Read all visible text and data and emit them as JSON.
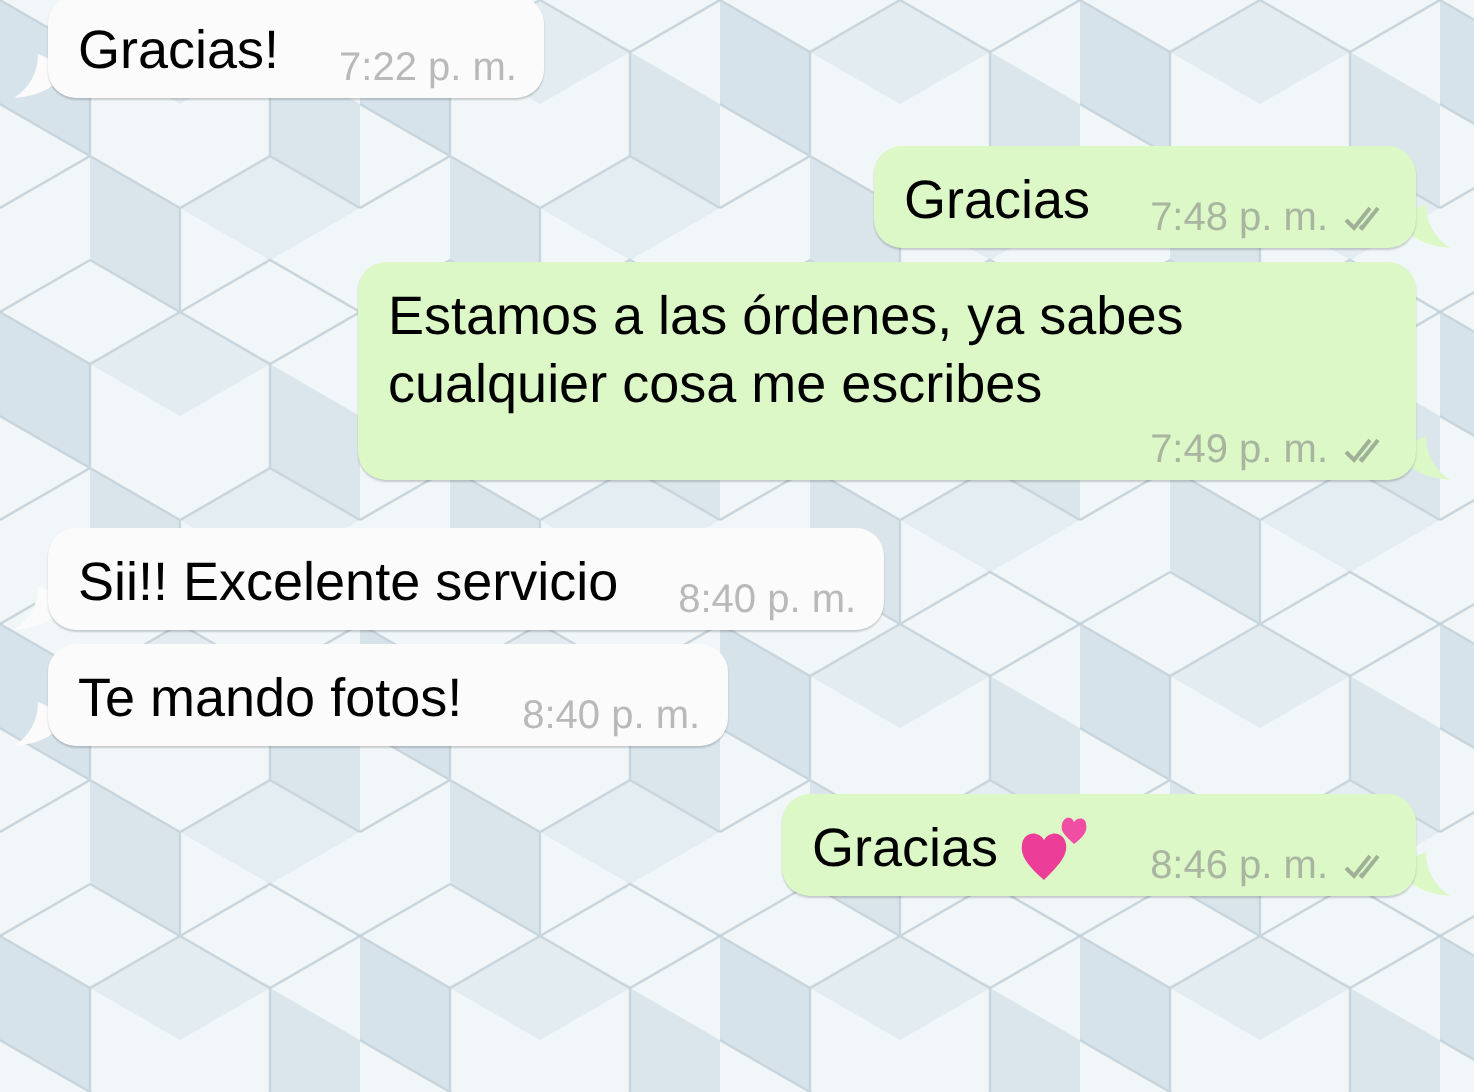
{
  "messages": [
    {
      "outgoing": false,
      "text": "Gracias!",
      "time": "7:22 p. m."
    },
    {
      "outgoing": true,
      "text": "Gracias",
      "time": "7:48 p. m.",
      "read": false
    },
    {
      "outgoing": true,
      "text": "Estamos a las órdenes, ya sabes cualquier cosa me escribes",
      "time": "7:49 p. m.",
      "read": false
    },
    {
      "outgoing": false,
      "text": "Sii!! Excelente servicio",
      "time": "8:40 p. m."
    },
    {
      "outgoing": false,
      "text": "Te mando fotos!",
      "time": "8:40 p. m."
    },
    {
      "outgoing": true,
      "text": "Gracias",
      "hearts": true,
      "time": "8:46 p. m.",
      "read": false
    }
  ]
}
